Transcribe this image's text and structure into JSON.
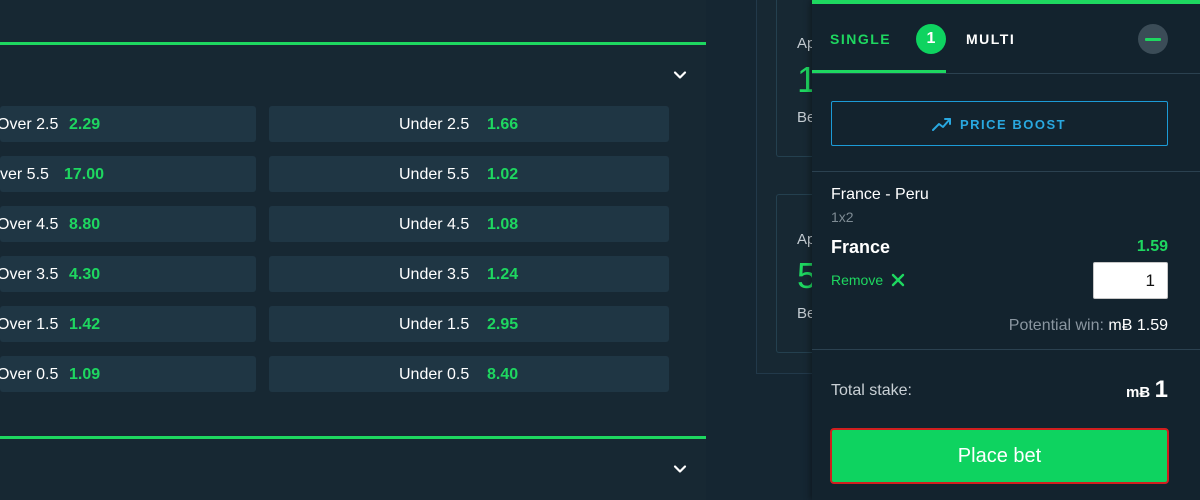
{
  "markets": {
    "rows": [
      {
        "left_label": "Over 2.5",
        "left_odds": "2.29",
        "right_label": "Under 2.5",
        "right_odds": "1.66"
      },
      {
        "left_label": "ver 5.5",
        "left_odds": "17.00",
        "right_label": "Under 5.5",
        "right_odds": "1.02"
      },
      {
        "left_label": "Over 4.5",
        "left_odds": "8.80",
        "right_label": "Under 4.5",
        "right_odds": "1.08"
      },
      {
        "left_label": "Over 3.5",
        "left_odds": "4.30",
        "right_label": "Under 3.5",
        "right_odds": "1.24"
      },
      {
        "left_label": "Over 1.5",
        "left_odds": "1.42",
        "right_label": "Under 1.5",
        "right_odds": "2.95"
      },
      {
        "left_label": "Over 0.5",
        "left_odds": "1.09",
        "right_label": "Under 0.5",
        "right_odds": "8.40"
      }
    ]
  },
  "middle": {
    "cards": [
      {
        "t1": "Ap",
        "t2": "1",
        "t3": "Be"
      },
      {
        "t1": "Ap",
        "t2": "5",
        "t3": "Be"
      }
    ]
  },
  "betslip": {
    "tab_single": "SINGLE",
    "single_count": "1",
    "tab_multi": "MULTI",
    "price_boost": "PRICE BOOST",
    "match": "France - Peru",
    "market": "1x2",
    "selection": "France",
    "odds": "1.59",
    "remove": "Remove",
    "stake": "1",
    "potential_label": "Potential win:",
    "currency": "mɃ",
    "potential_value": "1.59",
    "total_label": "Total stake:",
    "total_value": "1",
    "place_bet": "Place bet"
  },
  "colors": {
    "accent_green": "#1ed760",
    "button_green": "#0ed360",
    "boost_blue": "#29a8e0",
    "background": "#172833"
  }
}
